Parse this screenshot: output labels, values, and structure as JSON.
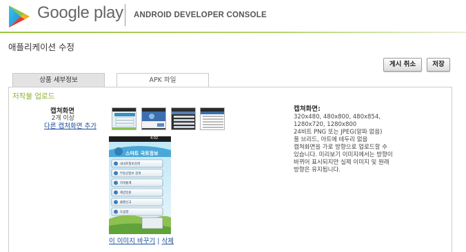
{
  "header": {
    "brand": "Google play",
    "console_title": "ANDROID DEVELOPER CONSOLE",
    "logo_icon": "google-play-triangle-icon",
    "accent_color": "#9ac33d"
  },
  "page": {
    "title": "애플리케이션 수정"
  },
  "toolbar": {
    "unpublish_label": "게시 취소",
    "save_label": "저장"
  },
  "tabs": [
    {
      "label": "상품 세부정보",
      "active": true
    },
    {
      "label": "APK 파일",
      "active": false
    }
  ],
  "section": {
    "title": "저작물 업로드"
  },
  "screenshots": {
    "label": "캡쳐화면",
    "requirement": "2개 이상",
    "add_link": "다른 캡쳐화면 추가",
    "replace_link": "이 이미지 바꾸기",
    "separator": "|",
    "delete_link": "삭제",
    "preview": {
      "status_time": "4:02",
      "app_banner": "스마트 국토정보",
      "menu_items": [
        "내국토정보검색",
        "부동산정보 검색",
        "지적통계",
        "해양민원",
        "불편신고",
        "도움말"
      ]
    }
  },
  "info": {
    "heading": "캡쳐화면:",
    "lines": [
      "320x480, 480x800, 480x854,",
      "1280x720, 1280x800",
      "24비트 PNG 또는 JPEG(알파 없음)",
      "풀 브리드, 아트에 테두리 없음",
      "캡쳐화면을 가로 방향으로 업로드할 수",
      "있습니다. 미리보기 이미지에서는 방향이",
      "바뀌어 표시되지만 실제 이미지 및 원래",
      "방향은 유지됩니다."
    ]
  }
}
